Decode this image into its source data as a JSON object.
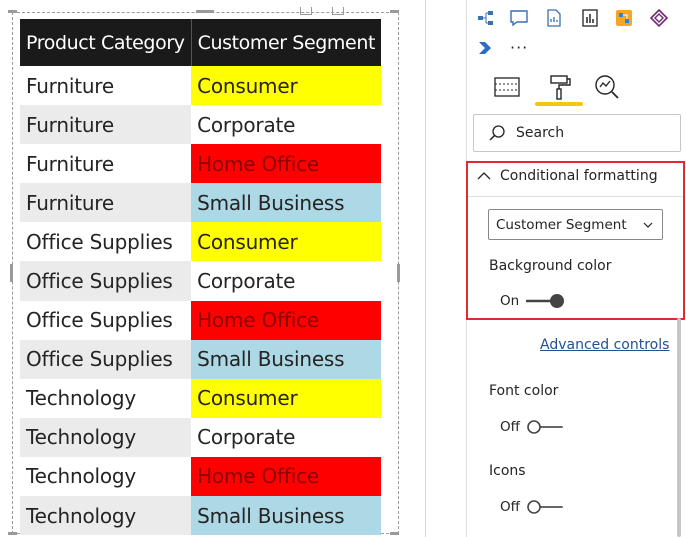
{
  "table": {
    "headers": [
      "Product Category",
      "Customer Segment"
    ],
    "rows": [
      {
        "category": "Furniture",
        "segment": "Consumer",
        "segment_bg": "#ffff00",
        "segment_color": "#252423"
      },
      {
        "category": "Furniture",
        "segment": "Corporate",
        "segment_bg": "#ffffff",
        "segment_color": "#252423"
      },
      {
        "category": "Furniture",
        "segment": "Home Office",
        "segment_bg": "#ff0000",
        "segment_color": "#8b0000"
      },
      {
        "category": "Furniture",
        "segment": "Small Business",
        "segment_bg": "#add8e6",
        "segment_color": "#252423"
      },
      {
        "category": "Office Supplies",
        "segment": "Consumer",
        "segment_bg": "#ffff00",
        "segment_color": "#252423"
      },
      {
        "category": "Office Supplies",
        "segment": "Corporate",
        "segment_bg": "#ffffff",
        "segment_color": "#252423"
      },
      {
        "category": "Office Supplies",
        "segment": "Home Office",
        "segment_bg": "#ff0000",
        "segment_color": "#8b0000"
      },
      {
        "category": "Office Supplies",
        "segment": "Small Business",
        "segment_bg": "#add8e6",
        "segment_color": "#252423"
      },
      {
        "category": "Technology",
        "segment": "Consumer",
        "segment_bg": "#ffff00",
        "segment_color": "#252423"
      },
      {
        "category": "Technology",
        "segment": "Corporate",
        "segment_bg": "#ffffff",
        "segment_color": "#252423"
      },
      {
        "category": "Technology",
        "segment": "Home Office",
        "segment_bg": "#ff0000",
        "segment_color": "#8b0000"
      },
      {
        "category": "Technology",
        "segment": "Small Business",
        "segment_bg": "#add8e6",
        "segment_color": "#252423"
      }
    ]
  },
  "pane": {
    "viz_icons": [
      "hierarchy-icon",
      "speech-bubble-icon",
      "document-chart-icon",
      "paginated-report-icon",
      "power-automate-icon",
      "power-apps-icon",
      "power-automate-chevron-icon"
    ],
    "more_label": "···",
    "tabs": [
      "fields-tab-icon",
      "format-paint-roller-icon",
      "analytics-magnifier-icon"
    ],
    "accent_color": "#f2c811",
    "search_placeholder": "Search",
    "section_title": "Conditional formatting",
    "field_selected": "Customer Segment",
    "background_color_label": "Background color",
    "background_color_state": "On",
    "advanced_controls_label": "Advanced controls",
    "font_color_label": "Font color",
    "font_color_state": "Off",
    "icons_label": "Icons",
    "icons_state": "Off",
    "highlight_color": "#e3292f"
  }
}
